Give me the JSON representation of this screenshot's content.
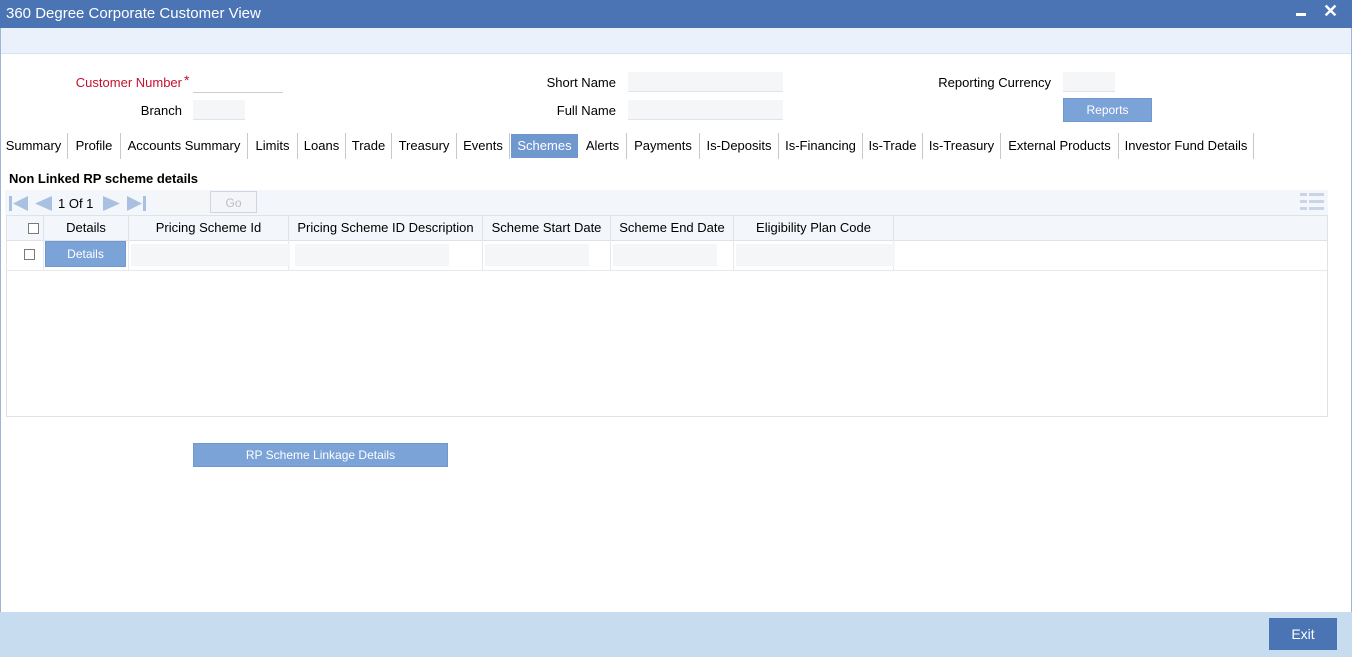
{
  "window": {
    "title": "360 Degree Corporate Customer View",
    "minimize_label": "",
    "close_label": "✕"
  },
  "form": {
    "customer_number_label": "Customer Number",
    "required_mark": "*",
    "customer_number_value": "",
    "branch_label": "Branch",
    "branch_value": "",
    "short_name_label": "Short Name",
    "short_name_value": "",
    "full_name_label": "Full Name",
    "full_name_value": "",
    "reporting_currency_label": "Reporting Currency",
    "reporting_currency_value": "",
    "reports_button": "Reports"
  },
  "tabs": [
    {
      "label": "Summary"
    },
    {
      "label": "Profile"
    },
    {
      "label": "Accounts Summary"
    },
    {
      "label": "Limits"
    },
    {
      "label": "Loans"
    },
    {
      "label": "Trade"
    },
    {
      "label": "Treasury"
    },
    {
      "label": "Events"
    },
    {
      "label": "Schemes"
    },
    {
      "label": "Alerts"
    },
    {
      "label": "Payments"
    },
    {
      "label": "Is-Deposits"
    },
    {
      "label": "Is-Financing"
    },
    {
      "label": "Is-Trade"
    },
    {
      "label": "Is-Treasury"
    },
    {
      "label": "External Products"
    },
    {
      "label": "Investor Fund Details"
    }
  ],
  "active_tab": "Schemes",
  "section": {
    "title": "Non Linked RP scheme details",
    "pager_text": "1 Of 1",
    "go_button": "Go",
    "columns": [
      "Details",
      "Pricing Scheme Id",
      "Pricing Scheme ID Description",
      "Scheme Start Date",
      "Scheme End Date",
      "Eligibility Plan Code"
    ],
    "rows": [
      {
        "details_button": "Details",
        "pricing_scheme_id": "",
        "description": "",
        "start_date": "",
        "end_date": "",
        "eligibility_plan_code": ""
      }
    ]
  },
  "linkage_button": "RP Scheme Linkage Details",
  "exit_button": "Exit"
}
